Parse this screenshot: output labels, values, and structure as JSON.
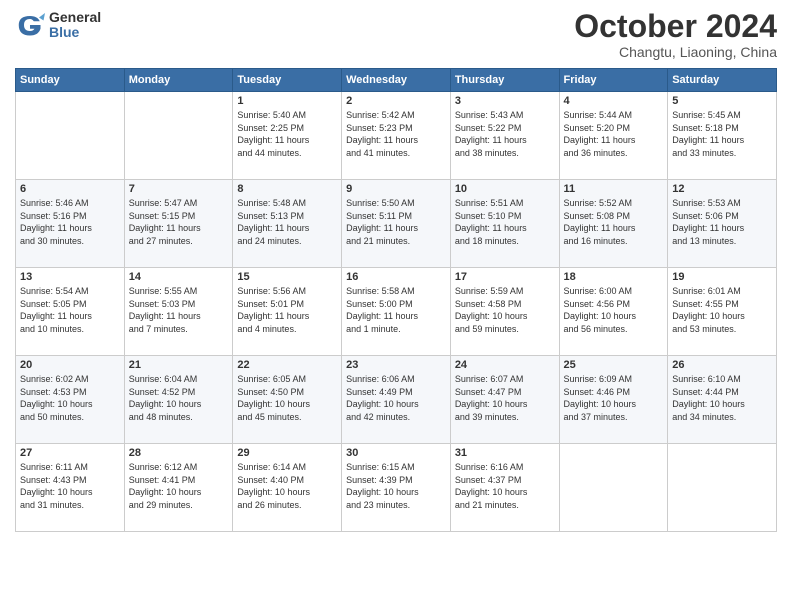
{
  "logo": {
    "general": "General",
    "blue": "Blue"
  },
  "header": {
    "month": "October 2024",
    "location": "Changtu, Liaoning, China"
  },
  "weekdays": [
    "Sunday",
    "Monday",
    "Tuesday",
    "Wednesday",
    "Thursday",
    "Friday",
    "Saturday"
  ],
  "weeks": [
    [
      {
        "day": "",
        "info": ""
      },
      {
        "day": "",
        "info": ""
      },
      {
        "day": "1",
        "info": "Sunrise: 5:40 AM\nSunset: 2:25 PM\nDaylight: 11 hours\nand 44 minutes."
      },
      {
        "day": "2",
        "info": "Sunrise: 5:42 AM\nSunset: 5:23 PM\nDaylight: 11 hours\nand 41 minutes."
      },
      {
        "day": "3",
        "info": "Sunrise: 5:43 AM\nSunset: 5:22 PM\nDaylight: 11 hours\nand 38 minutes."
      },
      {
        "day": "4",
        "info": "Sunrise: 5:44 AM\nSunset: 5:20 PM\nDaylight: 11 hours\nand 36 minutes."
      },
      {
        "day": "5",
        "info": "Sunrise: 5:45 AM\nSunset: 5:18 PM\nDaylight: 11 hours\nand 33 minutes."
      }
    ],
    [
      {
        "day": "6",
        "info": "Sunrise: 5:46 AM\nSunset: 5:16 PM\nDaylight: 11 hours\nand 30 minutes."
      },
      {
        "day": "7",
        "info": "Sunrise: 5:47 AM\nSunset: 5:15 PM\nDaylight: 11 hours\nand 27 minutes."
      },
      {
        "day": "8",
        "info": "Sunrise: 5:48 AM\nSunset: 5:13 PM\nDaylight: 11 hours\nand 24 minutes."
      },
      {
        "day": "9",
        "info": "Sunrise: 5:50 AM\nSunset: 5:11 PM\nDaylight: 11 hours\nand 21 minutes."
      },
      {
        "day": "10",
        "info": "Sunrise: 5:51 AM\nSunset: 5:10 PM\nDaylight: 11 hours\nand 18 minutes."
      },
      {
        "day": "11",
        "info": "Sunrise: 5:52 AM\nSunset: 5:08 PM\nDaylight: 11 hours\nand 16 minutes."
      },
      {
        "day": "12",
        "info": "Sunrise: 5:53 AM\nSunset: 5:06 PM\nDaylight: 11 hours\nand 13 minutes."
      }
    ],
    [
      {
        "day": "13",
        "info": "Sunrise: 5:54 AM\nSunset: 5:05 PM\nDaylight: 11 hours\nand 10 minutes."
      },
      {
        "day": "14",
        "info": "Sunrise: 5:55 AM\nSunset: 5:03 PM\nDaylight: 11 hours\nand 7 minutes."
      },
      {
        "day": "15",
        "info": "Sunrise: 5:56 AM\nSunset: 5:01 PM\nDaylight: 11 hours\nand 4 minutes."
      },
      {
        "day": "16",
        "info": "Sunrise: 5:58 AM\nSunset: 5:00 PM\nDaylight: 11 hours\nand 1 minute."
      },
      {
        "day": "17",
        "info": "Sunrise: 5:59 AM\nSunset: 4:58 PM\nDaylight: 10 hours\nand 59 minutes."
      },
      {
        "day": "18",
        "info": "Sunrise: 6:00 AM\nSunset: 4:56 PM\nDaylight: 10 hours\nand 56 minutes."
      },
      {
        "day": "19",
        "info": "Sunrise: 6:01 AM\nSunset: 4:55 PM\nDaylight: 10 hours\nand 53 minutes."
      }
    ],
    [
      {
        "day": "20",
        "info": "Sunrise: 6:02 AM\nSunset: 4:53 PM\nDaylight: 10 hours\nand 50 minutes."
      },
      {
        "day": "21",
        "info": "Sunrise: 6:04 AM\nSunset: 4:52 PM\nDaylight: 10 hours\nand 48 minutes."
      },
      {
        "day": "22",
        "info": "Sunrise: 6:05 AM\nSunset: 4:50 PM\nDaylight: 10 hours\nand 45 minutes."
      },
      {
        "day": "23",
        "info": "Sunrise: 6:06 AM\nSunset: 4:49 PM\nDaylight: 10 hours\nand 42 minutes."
      },
      {
        "day": "24",
        "info": "Sunrise: 6:07 AM\nSunset: 4:47 PM\nDaylight: 10 hours\nand 39 minutes."
      },
      {
        "day": "25",
        "info": "Sunrise: 6:09 AM\nSunset: 4:46 PM\nDaylight: 10 hours\nand 37 minutes."
      },
      {
        "day": "26",
        "info": "Sunrise: 6:10 AM\nSunset: 4:44 PM\nDaylight: 10 hours\nand 34 minutes."
      }
    ],
    [
      {
        "day": "27",
        "info": "Sunrise: 6:11 AM\nSunset: 4:43 PM\nDaylight: 10 hours\nand 31 minutes."
      },
      {
        "day": "28",
        "info": "Sunrise: 6:12 AM\nSunset: 4:41 PM\nDaylight: 10 hours\nand 29 minutes."
      },
      {
        "day": "29",
        "info": "Sunrise: 6:14 AM\nSunset: 4:40 PM\nDaylight: 10 hours\nand 26 minutes."
      },
      {
        "day": "30",
        "info": "Sunrise: 6:15 AM\nSunset: 4:39 PM\nDaylight: 10 hours\nand 23 minutes."
      },
      {
        "day": "31",
        "info": "Sunrise: 6:16 AM\nSunset: 4:37 PM\nDaylight: 10 hours\nand 21 minutes."
      },
      {
        "day": "",
        "info": ""
      },
      {
        "day": "",
        "info": ""
      }
    ]
  ]
}
